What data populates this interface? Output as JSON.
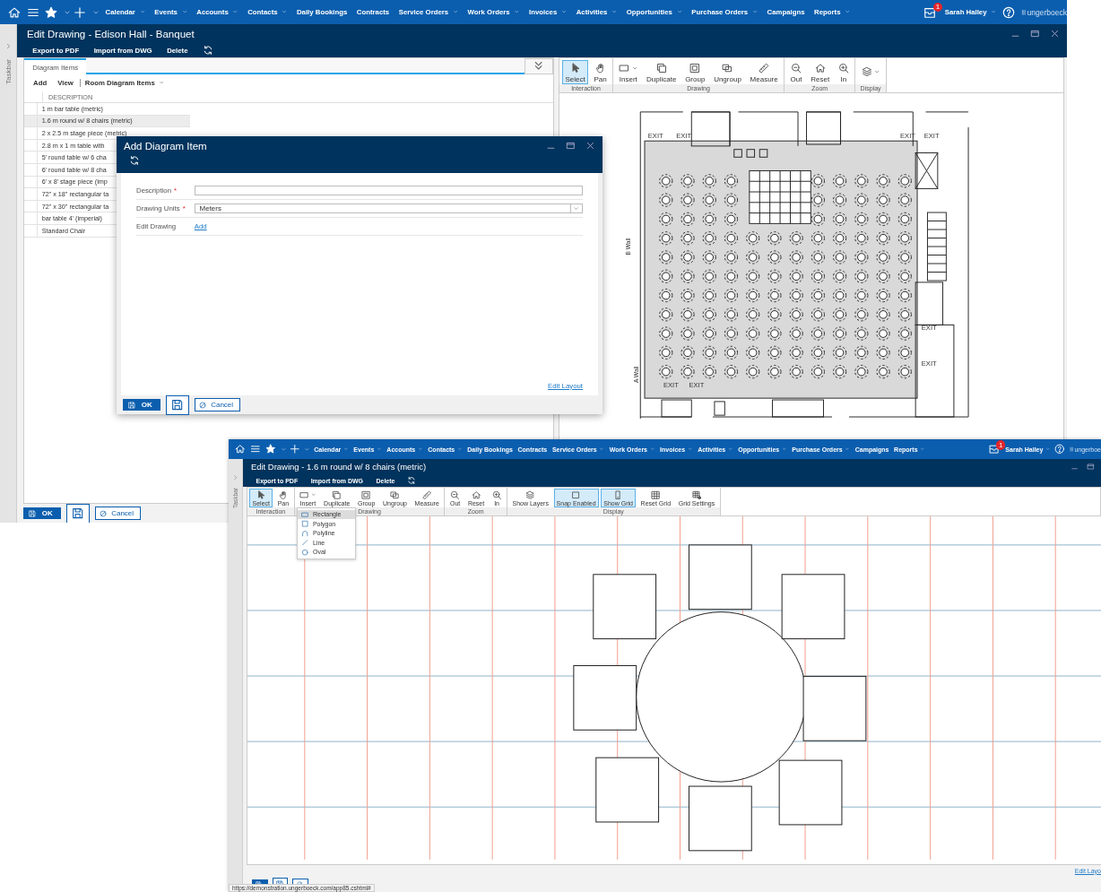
{
  "back_window": {
    "nav": {
      "items": [
        {
          "label": "Calendar",
          "dropdown": true
        },
        {
          "label": "Events",
          "dropdown": true
        },
        {
          "label": "Accounts",
          "dropdown": true
        },
        {
          "label": "Contacts",
          "dropdown": true
        },
        {
          "label": "Daily Bookings",
          "dropdown": false
        },
        {
          "label": "Contracts",
          "dropdown": false
        },
        {
          "label": "Service Orders",
          "dropdown": true
        },
        {
          "label": "Work Orders",
          "dropdown": true
        },
        {
          "label": "Invoices",
          "dropdown": true
        },
        {
          "label": "Activities",
          "dropdown": true
        },
        {
          "label": "Opportunities",
          "dropdown": true
        },
        {
          "label": "Purchase Orders",
          "dropdown": true
        },
        {
          "label": "Campaigns",
          "dropdown": false
        },
        {
          "label": "Reports",
          "dropdown": true
        }
      ],
      "notifications": "1",
      "user": "Sarah Halley",
      "brand": "ungerboeck"
    },
    "title": "Edit Drawing - Edison Hall - Banquet",
    "close_button": true,
    "actions": [
      "Export to PDF",
      "Import from DWG",
      "Delete"
    ],
    "taskbar": "Taskbar",
    "panel": {
      "tabs": [
        {
          "label": "Diagram Items",
          "selected": true
        }
      ],
      "add": "Add",
      "view": "View",
      "view_value": "Room Diagram Items",
      "column": "DESCRIPTION",
      "rows": [
        {
          "text": "1 m bar table (metric)",
          "selected": false
        },
        {
          "text": "1.6 m round w/ 8 chairs (metric)",
          "selected": true
        },
        {
          "text": "2 x 2.5 m stage piece (metric)",
          "selected": false
        },
        {
          "text": "2.8 m x 1 m table with",
          "selected": false
        },
        {
          "text": "5' round table w/ 6 cha",
          "selected": false
        },
        {
          "text": "6' round table w/ 8 cha",
          "selected": false
        },
        {
          "text": "6' x 8' stage piece (imp",
          "selected": false
        },
        {
          "text": "72\" x 18\" rectangular ta",
          "selected": false
        },
        {
          "text": "72\" x 30\" rectangular ta",
          "selected": false
        },
        {
          "text": "bar table 4' (imperial)",
          "selected": false
        },
        {
          "text": "Standard Chair",
          "selected": false
        }
      ]
    },
    "toolbar": [
      {
        "label": "Interaction",
        "tools": [
          {
            "label": "Select",
            "kind": "pointer",
            "selected": true,
            "dropdown": false
          },
          {
            "label": "Pan",
            "kind": "hand",
            "selected": false,
            "dropdown": false
          }
        ]
      },
      {
        "label": "Drawing",
        "tools": [
          {
            "label": "Insert",
            "kind": "rectangle",
            "selected": false,
            "dropdown": true
          },
          {
            "label": "Duplicate",
            "kind": "copy",
            "selected": false,
            "dropdown": false
          },
          {
            "label": "Group",
            "kind": "group",
            "selected": false,
            "dropdown": false
          },
          {
            "label": "Ungroup",
            "kind": "ungroup",
            "selected": false,
            "dropdown": false
          },
          {
            "label": "Measure",
            "kind": "ruler",
            "selected": false,
            "dropdown": false
          }
        ]
      },
      {
        "label": "Zoom",
        "tools": [
          {
            "label": "Out",
            "kind": "zoom-out",
            "selected": false,
            "dropdown": false
          },
          {
            "label": "Reset",
            "kind": "home",
            "selected": false,
            "dropdown": false
          },
          {
            "label": "In",
            "kind": "zoom-in",
            "selected": false,
            "dropdown": false
          }
        ]
      },
      {
        "label": "Display",
        "tools": [
          {
            "kind": "layers",
            "selected": false,
            "dropdown": true
          }
        ]
      }
    ],
    "floor_plan": {
      "wall_labels": [
        "B Wall",
        "A Wall"
      ],
      "exit_labels": [
        "EXIT",
        "EXIT",
        "EXIT",
        "EXIT",
        "EXIT",
        "EXIT",
        "EXIT",
        "EXIT"
      ]
    },
    "footer": {
      "ok": "OK",
      "cancel": "Cancel"
    }
  },
  "dialog": {
    "title": "Add Diagram Item",
    "close_button": true,
    "fields": [
      {
        "label": "Description",
        "required_mark": "*",
        "kind": "input"
      },
      {
        "label": "Drawing Units",
        "required_mark": "*",
        "kind": "select",
        "value": "Meters"
      },
      {
        "label": "Edit Drawing",
        "kind": "link",
        "value": "Add"
      }
    ],
    "edit_layout": "Edit Layout",
    "footer": {
      "ok": "OK",
      "cancel": "Cancel"
    }
  },
  "front_window": {
    "nav": {
      "items": [
        {
          "label": "Calendar",
          "dropdown": true
        },
        {
          "label": "Events",
          "dropdown": true
        },
        {
          "label": "Accounts",
          "dropdown": true
        },
        {
          "label": "Contacts",
          "dropdown": true
        },
        {
          "label": "Daily Bookings",
          "dropdown": false
        },
        {
          "label": "Contracts",
          "dropdown": false
        },
        {
          "label": "Service Orders",
          "dropdown": true
        },
        {
          "label": "Work Orders",
          "dropdown": true
        },
        {
          "label": "Invoices",
          "dropdown": true
        },
        {
          "label": "Activities",
          "dropdown": true
        },
        {
          "label": "Opportunities",
          "dropdown": true
        },
        {
          "label": "Purchase Orders",
          "dropdown": true
        },
        {
          "label": "Campaigns",
          "dropdown": false
        },
        {
          "label": "Reports",
          "dropdown": true
        }
      ],
      "notifications": "1",
      "user": "Sarah Halley",
      "brand": "ungerboe"
    },
    "title": "Edit Drawing - 1.6 m round w/ 8 chairs (metric)",
    "close_button": false,
    "actions": [
      "Export to PDF",
      "Import from DWG",
      "Delete"
    ],
    "taskbar": "Taskbar",
    "toolbar": [
      {
        "label": "Interaction",
        "tools": [
          {
            "label": "Select",
            "kind": "pointer",
            "selected": true,
            "dropdown": false
          },
          {
            "label": "Pan",
            "kind": "hand",
            "selected": false,
            "dropdown": false
          }
        ]
      },
      {
        "label": "Drawing",
        "tools": [
          {
            "label": "Insert",
            "kind": "rectangle",
            "selected": false,
            "dropdown": true,
            "menu": [
              {
                "label": "Rectangle",
                "kind": "rectangle",
                "selected": true
              },
              {
                "label": "Polygon",
                "kind": "dotted-square",
                "selected": false
              },
              {
                "label": "Polyline",
                "kind": "arc",
                "selected": false
              },
              {
                "label": "Line",
                "kind": "line",
                "selected": false
              },
              {
                "label": "Oval",
                "kind": "circle",
                "selected": false
              }
            ]
          },
          {
            "label": "Duplicate",
            "kind": "copy",
            "selected": false,
            "dropdown": false
          },
          {
            "label": "Group",
            "kind": "group",
            "selected": false,
            "dropdown": false
          },
          {
            "label": "Ungroup",
            "kind": "ungroup",
            "selected": false,
            "dropdown": false
          },
          {
            "label": "Measure",
            "kind": "ruler",
            "selected": false,
            "dropdown": false
          }
        ]
      },
      {
        "label": "Zoom",
        "tools": [
          {
            "label": "Out",
            "kind": "zoom-out",
            "selected": false,
            "dropdown": false
          },
          {
            "label": "Reset",
            "kind": "home",
            "selected": false,
            "dropdown": false
          },
          {
            "label": "In",
            "kind": "zoom-in",
            "selected": false,
            "dropdown": false
          }
        ]
      },
      {
        "label": "Display",
        "tools": [
          {
            "label": "Show Layers",
            "kind": "layers",
            "selected": false,
            "dropdown": false
          },
          {
            "label": "Snap Enabled",
            "kind": "square",
            "selected": true,
            "dropdown": false
          },
          {
            "label": "Show Grid",
            "kind": "vertical-rectangle",
            "selected": true,
            "dropdown": false
          },
          {
            "label": "Reset Grid",
            "kind": "grid",
            "selected": false,
            "dropdown": false
          },
          {
            "label": "Grid Settings",
            "kind": "grid-gear",
            "selected": false,
            "dropdown": false
          }
        ]
      }
    ],
    "edit_layout": "Edit Layo"
  },
  "status_url": "https://demonstration.ungerboeck.com/app85.cshtml#"
}
